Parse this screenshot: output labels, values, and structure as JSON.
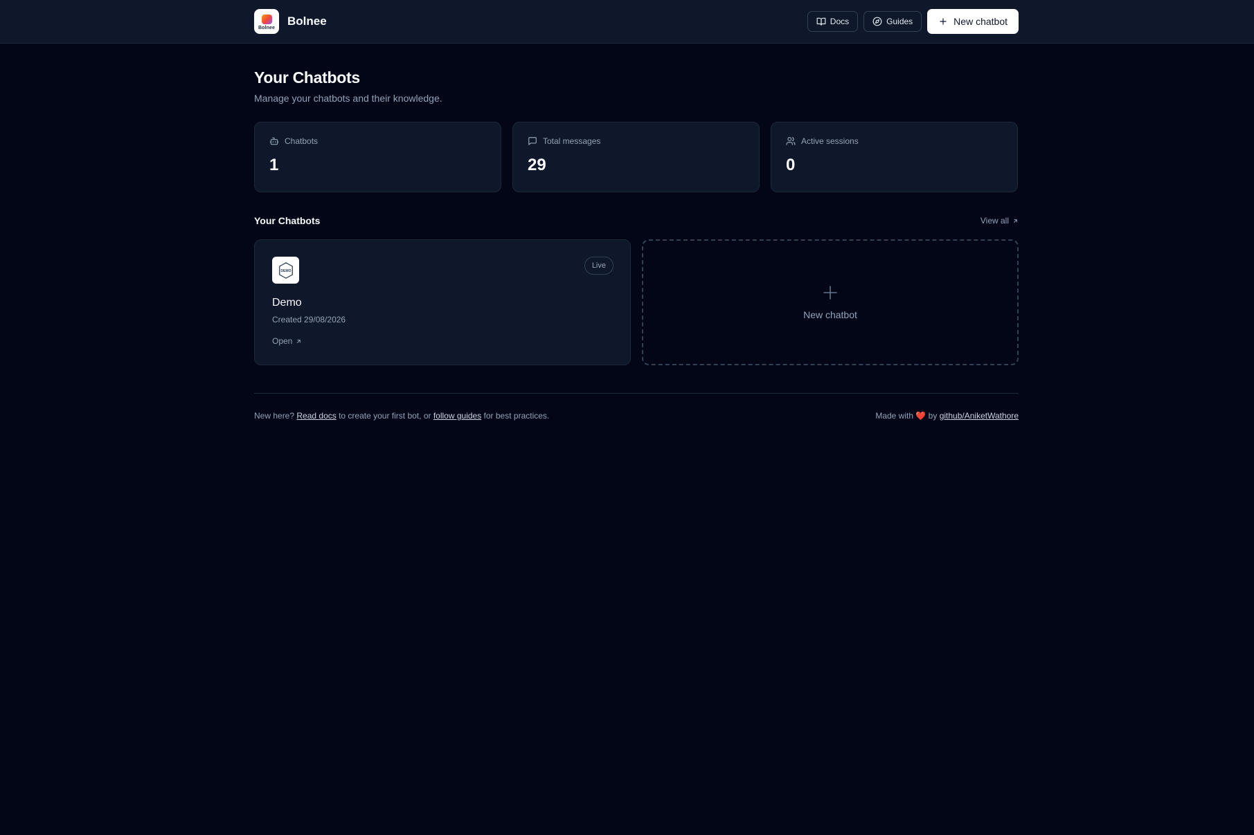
{
  "header": {
    "logo_text": "Bolnee",
    "brand_name": "Bolnee",
    "docs_label": "Docs",
    "guides_label": "Guides",
    "new_chatbot_label": "New chatbot"
  },
  "page": {
    "title": "Your Chatbots",
    "subtitle": "Manage your chatbots and their knowledge."
  },
  "stats": [
    {
      "label": "Chatbots",
      "value": "1",
      "icon": "bot-icon"
    },
    {
      "label": "Total messages",
      "value": "29",
      "icon": "message-icon"
    },
    {
      "label": "Active sessions",
      "value": "0",
      "icon": "users-icon"
    }
  ],
  "section": {
    "title": "Your Chatbots",
    "view_all": "View all"
  },
  "chatbots": [
    {
      "logo_text": "DEMO",
      "status": "Live",
      "name": "Demo",
      "created": "Created 29/08/2026",
      "open_label": "Open"
    }
  ],
  "new_card": {
    "label": "New chatbot"
  },
  "footer": {
    "text_1": "New here?",
    "read_docs": "Read docs",
    "text_2": "to create your first bot, or",
    "follow_guides": "follow guides",
    "text_3": "for best practices.",
    "made_with": "Made with",
    "heart": "❤️",
    "by": "by",
    "credit_link": "github/AniketWathore"
  },
  "colors": {
    "background": "#020617",
    "surface": "#0f172a",
    "border": "#1e293b",
    "muted_text": "#94a3b8",
    "primary_button": "#ffffff"
  }
}
